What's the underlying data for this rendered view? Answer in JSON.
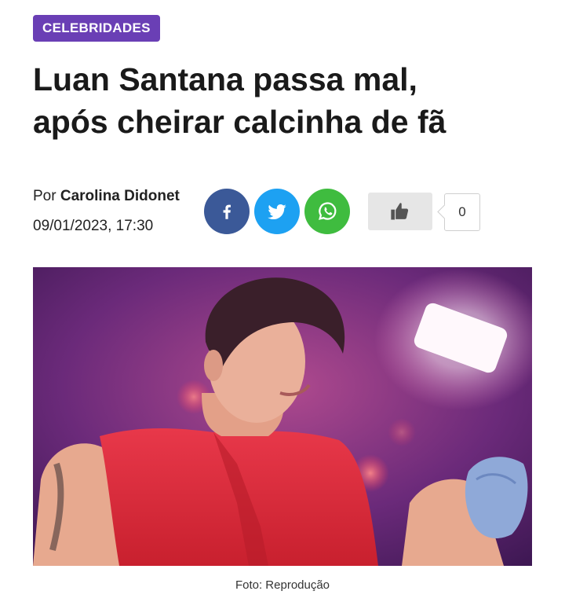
{
  "category": "CELEBRIDADES",
  "headline": {
    "line1": "Luan Santana passa mal,",
    "line2": "após cheirar calcinha de fã"
  },
  "byline": {
    "prefix": "Por",
    "author": "Carolina Didonet",
    "datetime": "09/01/2023, 17:30"
  },
  "share": {
    "items": [
      {
        "network": "facebook",
        "icon": "facebook-icon",
        "color": "#3b5998"
      },
      {
        "network": "twitter",
        "icon": "twitter-icon",
        "color": "#1da1f2"
      },
      {
        "network": "whatsapp",
        "icon": "whatsapp-icon",
        "color": "#3fbc3f"
      }
    ]
  },
  "like": {
    "icon": "thumbs-up-icon",
    "count": "0"
  },
  "photo": {
    "caption": "Foto: Reprodução"
  },
  "colors": {
    "badge": "#6a3fb5",
    "headline": "#1a1a1a"
  }
}
